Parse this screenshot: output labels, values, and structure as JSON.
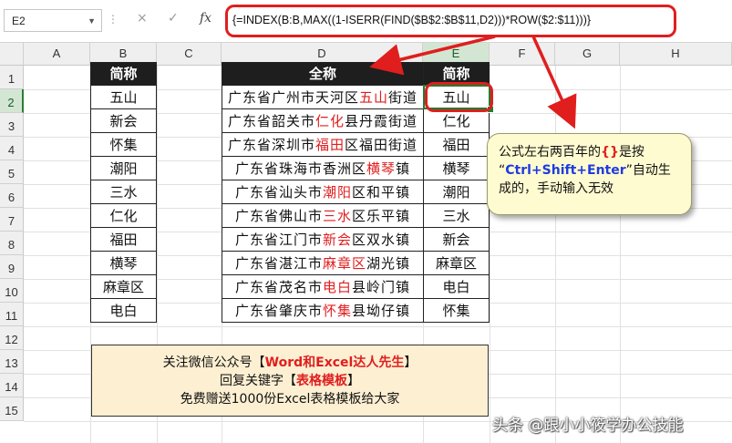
{
  "formula_bar": {
    "name_box": "E2",
    "cancel_icon": "×",
    "enter_icon": "✓",
    "fx_label": "fx",
    "formula": "{=INDEX(B:B,MAX((1-ISERR(FIND($B$2:$B$11,D2)))*ROW($2:$11)))}"
  },
  "columns": [
    "A",
    "B",
    "C",
    "D",
    "E",
    "F",
    "G",
    "H"
  ],
  "rows": [
    "1",
    "2",
    "3",
    "4",
    "5",
    "6",
    "7",
    "8",
    "9",
    "10",
    "11",
    "12",
    "13",
    "14",
    "15"
  ],
  "left_table": {
    "header": "简称",
    "items": [
      "五山",
      "新会",
      "怀集",
      "潮阳",
      "三水",
      "仁化",
      "福田",
      "横琴",
      "麻章区",
      "电白"
    ]
  },
  "right_table": {
    "header_full": "全称",
    "header_short": "简称",
    "rows": [
      {
        "pre": "广东省广州市天河区",
        "hl": "五山",
        "post": "街道",
        "short": "五山"
      },
      {
        "pre": "广东省韶关市",
        "hl": "仁化",
        "post": "县丹霞街道",
        "short": "仁化"
      },
      {
        "pre": "广东省深圳市",
        "hl": "福田",
        "post": "区福田街道",
        "short": "福田"
      },
      {
        "pre": "广东省珠海市香洲区",
        "hl": "横琴",
        "post": "镇",
        "short": "横琴"
      },
      {
        "pre": "广东省汕头市",
        "hl": "潮阳",
        "post": "区和平镇",
        "short": "潮阳"
      },
      {
        "pre": "广东省佛山市",
        "hl": "三水",
        "post": "区乐平镇",
        "short": "三水"
      },
      {
        "pre": "广东省江门市",
        "hl": "新会",
        "post": "区双水镇",
        "short": "新会"
      },
      {
        "pre": "广东省湛江市",
        "hl": "麻章区",
        "post": "湖光镇",
        "short": "麻章区"
      },
      {
        "pre": "广东省茂名市",
        "hl": "电白",
        "post": "县岭门镇",
        "short": "电白"
      },
      {
        "pre": "广东省肇庆市",
        "hl": "怀集",
        "post": "县坳仔镇",
        "short": "怀集"
      }
    ]
  },
  "callout": {
    "line1_pre": "公式左右两百年的",
    "line1_braces": "{}",
    "line1_post": "是按",
    "quote_open": "“",
    "keys": "Ctrl+Shift+Enter",
    "quote_close": "”",
    "line2_post": "自动生",
    "line3": "成的，手动输入无效"
  },
  "promo": {
    "line1_pre": "关注微信公众号【",
    "line1_hl": "Word和Excel达人先生",
    "line1_post": "】",
    "line2_pre": "回复关键字【",
    "line2_hl": "表格模板",
    "line2_post": "】",
    "line3": "免费赠送1000份Excel表格模板给大家"
  },
  "watermark": "头条 @跟小小筱学办公技能",
  "colors": {
    "highlight": "#e01e1e",
    "arrow": "#e01e1e",
    "selected": "#1e7e34",
    "note_bg": "#fffbd0",
    "promo_bg": "#fdefd2"
  }
}
